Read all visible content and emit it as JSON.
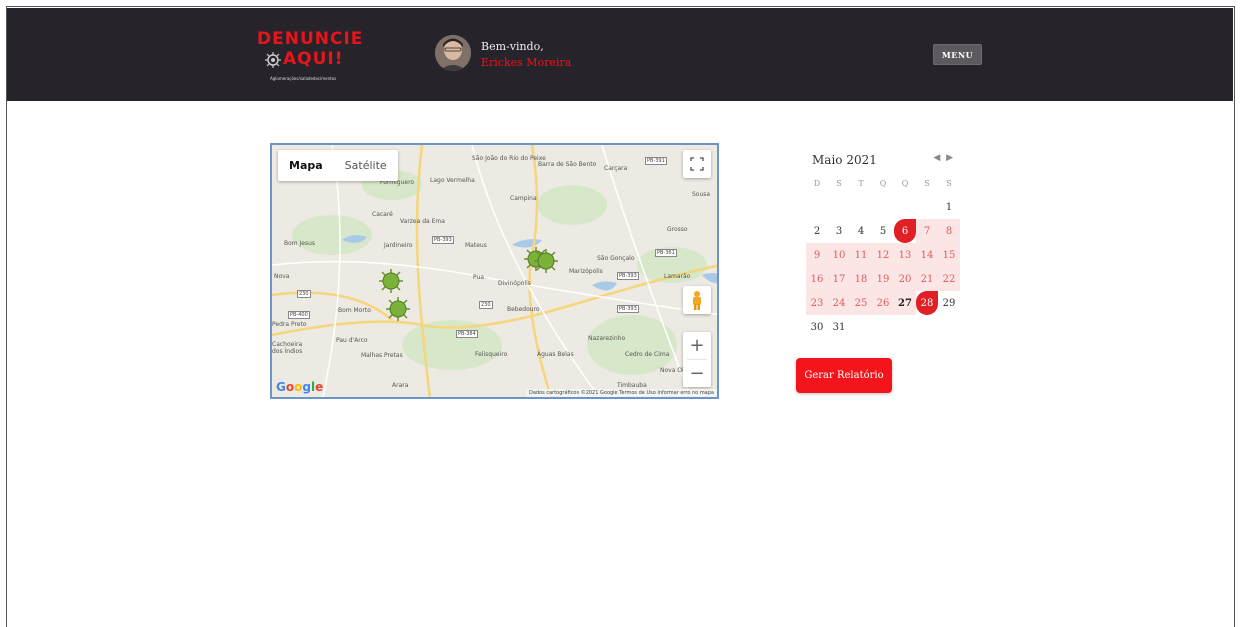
{
  "header": {
    "logo_line1": "DENUNCIE",
    "logo_line2": "AQUI!",
    "logo_tagline": "Aglomerações/saladedecimentos",
    "welcome": "Bem-vindo,",
    "username": "Erickes Moreira",
    "menu_label": "MENU"
  },
  "map": {
    "type_map": "Mapa",
    "type_satellite": "Satélite",
    "google": "Google",
    "attribution": "Dados cartográficos ©2021 Google   Termos de Uso   Informar erro no mapa",
    "labels": [
      "São João do Rio do Peixe",
      "Barra de São Bento",
      "Carçara",
      "Formiguero",
      "Lago Vermelha",
      "Campina",
      "Sousa",
      "Cacaré",
      "Varzea da Ema",
      "Grosso",
      "Bom Jesus",
      "Jardineiro",
      "Mateus",
      "São Gonçalo",
      "Marizópolis",
      "Lamarão",
      "Nova",
      "Pua",
      "Divinópolis",
      "Bom Morto",
      "Bebedouro",
      "Pedra Preto",
      "Pau d'Arco",
      "Nazarezinho",
      "Cachoeira dos Índios",
      "Malhas Pretas",
      "Felisqueiro",
      "Águas Belas",
      "Cedro de Cima",
      "Nova Ol",
      "Arara",
      "Timbauba"
    ],
    "road_tags": [
      "PB-391",
      "PB-393",
      "PB-361",
      "PB-393",
      "230",
      "PB-400",
      "PB-393",
      "PB-384",
      "230"
    ]
  },
  "calendar": {
    "month_label": "Maio 2021",
    "weekdays": [
      "D",
      "S",
      "T",
      "Q",
      "Q",
      "S",
      "S"
    ],
    "days": [
      {
        "d": "",
        "s": ""
      },
      {
        "d": "",
        "s": ""
      },
      {
        "d": "",
        "s": ""
      },
      {
        "d": "",
        "s": ""
      },
      {
        "d": "",
        "s": ""
      },
      {
        "d": "",
        "s": ""
      },
      {
        "d": "1",
        "s": ""
      },
      {
        "d": "2",
        "s": ""
      },
      {
        "d": "3",
        "s": ""
      },
      {
        "d": "4",
        "s": ""
      },
      {
        "d": "5",
        "s": ""
      },
      {
        "d": "6",
        "s": "sel"
      },
      {
        "d": "7",
        "s": "hl"
      },
      {
        "d": "8",
        "s": "hl"
      },
      {
        "d": "9",
        "s": "hl"
      },
      {
        "d": "10",
        "s": "hl"
      },
      {
        "d": "11",
        "s": "hl"
      },
      {
        "d": "12",
        "s": "hl"
      },
      {
        "d": "13",
        "s": "hl"
      },
      {
        "d": "14",
        "s": "hl"
      },
      {
        "d": "15",
        "s": "hl"
      },
      {
        "d": "16",
        "s": "hl"
      },
      {
        "d": "17",
        "s": "hl"
      },
      {
        "d": "18",
        "s": "hl"
      },
      {
        "d": "19",
        "s": "hl"
      },
      {
        "d": "20",
        "s": "hl"
      },
      {
        "d": "21",
        "s": "hl"
      },
      {
        "d": "22",
        "s": "hl"
      },
      {
        "d": "23",
        "s": "hl"
      },
      {
        "d": "24",
        "s": "hl"
      },
      {
        "d": "25",
        "s": "hl"
      },
      {
        "d": "26",
        "s": "hl"
      },
      {
        "d": "27",
        "s": "hl bold"
      },
      {
        "d": "28",
        "s": "sel"
      },
      {
        "d": "29",
        "s": ""
      },
      {
        "d": "30",
        "s": ""
      },
      {
        "d": "31",
        "s": ""
      }
    ],
    "report_button": "Gerar Relatório"
  },
  "colors": {
    "accent": "#f3141c",
    "topbar": "#26242a",
    "marker": "#7bb33a"
  }
}
